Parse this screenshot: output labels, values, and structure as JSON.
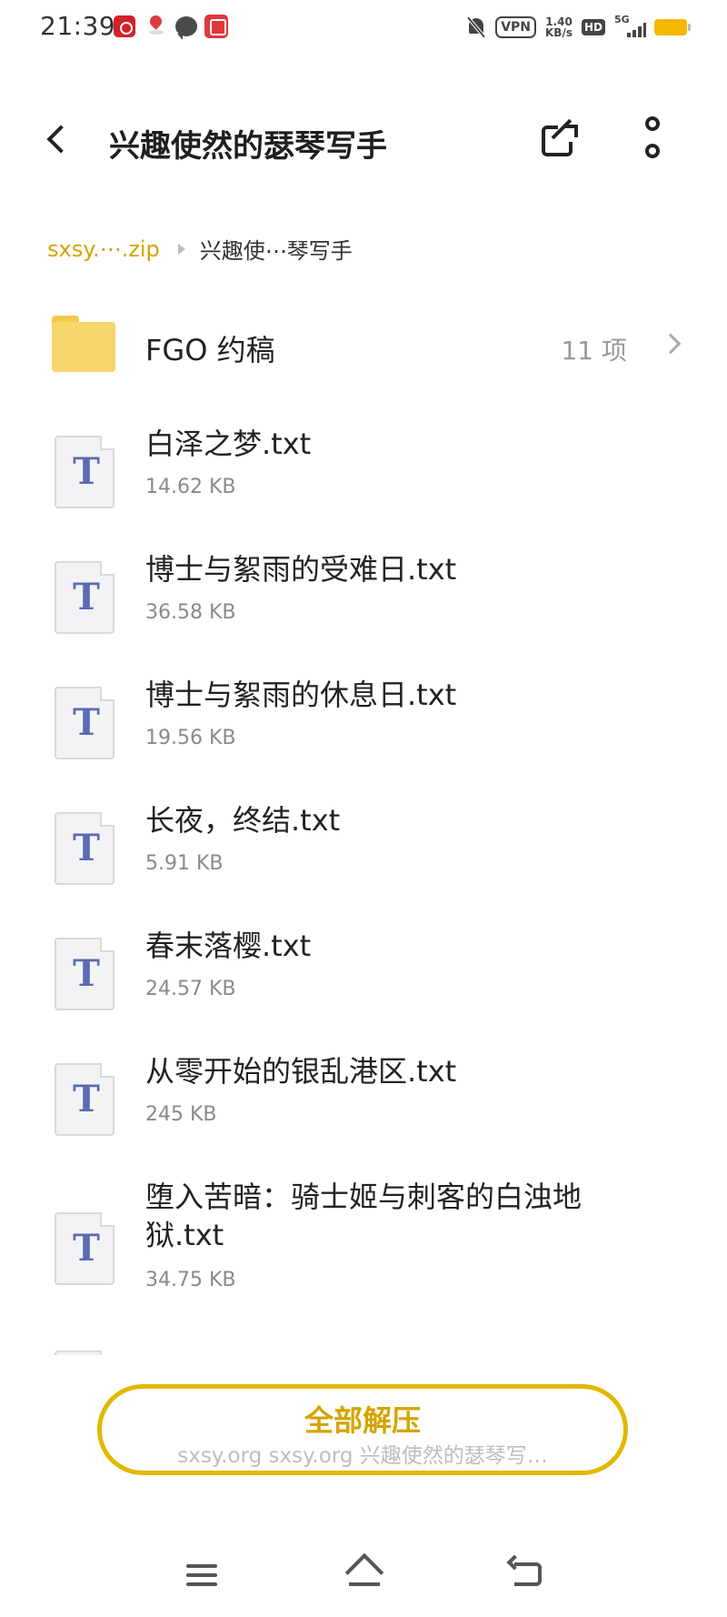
{
  "status_bar": {
    "time": "21:39",
    "vpn": "VPN",
    "speed_value": "1.40",
    "speed_unit": "KB/s",
    "hd": "HD",
    "network": "5G",
    "battery_color": "#f6b800"
  },
  "header": {
    "title": "兴趣使然的瑟琴写手"
  },
  "breadcrumb": {
    "archive": "sxsy.⋯.zip",
    "current": "兴趣使⋯琴写手"
  },
  "folder": {
    "name": "FGO 约稿",
    "count": "11 项"
  },
  "files": [
    {
      "name": "白泽之梦.txt",
      "size": "14.62 KB"
    },
    {
      "name": "博士与絮雨的受难日.txt",
      "size": "36.58 KB"
    },
    {
      "name": "博士与絮雨的休息日.txt",
      "size": "19.56 KB"
    },
    {
      "name": "长夜，终结.txt",
      "size": "5.91 KB"
    },
    {
      "name": "春末落樱.txt",
      "size": "24.57 KB"
    },
    {
      "name": "从零开始的银乱港区.txt",
      "size": "245 KB"
    },
    {
      "name": "堕入苦暗：骑士姬与刺客的白浊地狱.txt",
      "size": "34.75 KB"
    }
  ],
  "file_icon_glyph": "T",
  "extract": {
    "label": "全部解压",
    "path": "sxsy.org  sxsy.org 兴趣使然的瑟琴写…"
  },
  "colors": {
    "accent": "#d4a400",
    "folder": "#f7d66b",
    "file_glyph": "#5b6bb0"
  }
}
